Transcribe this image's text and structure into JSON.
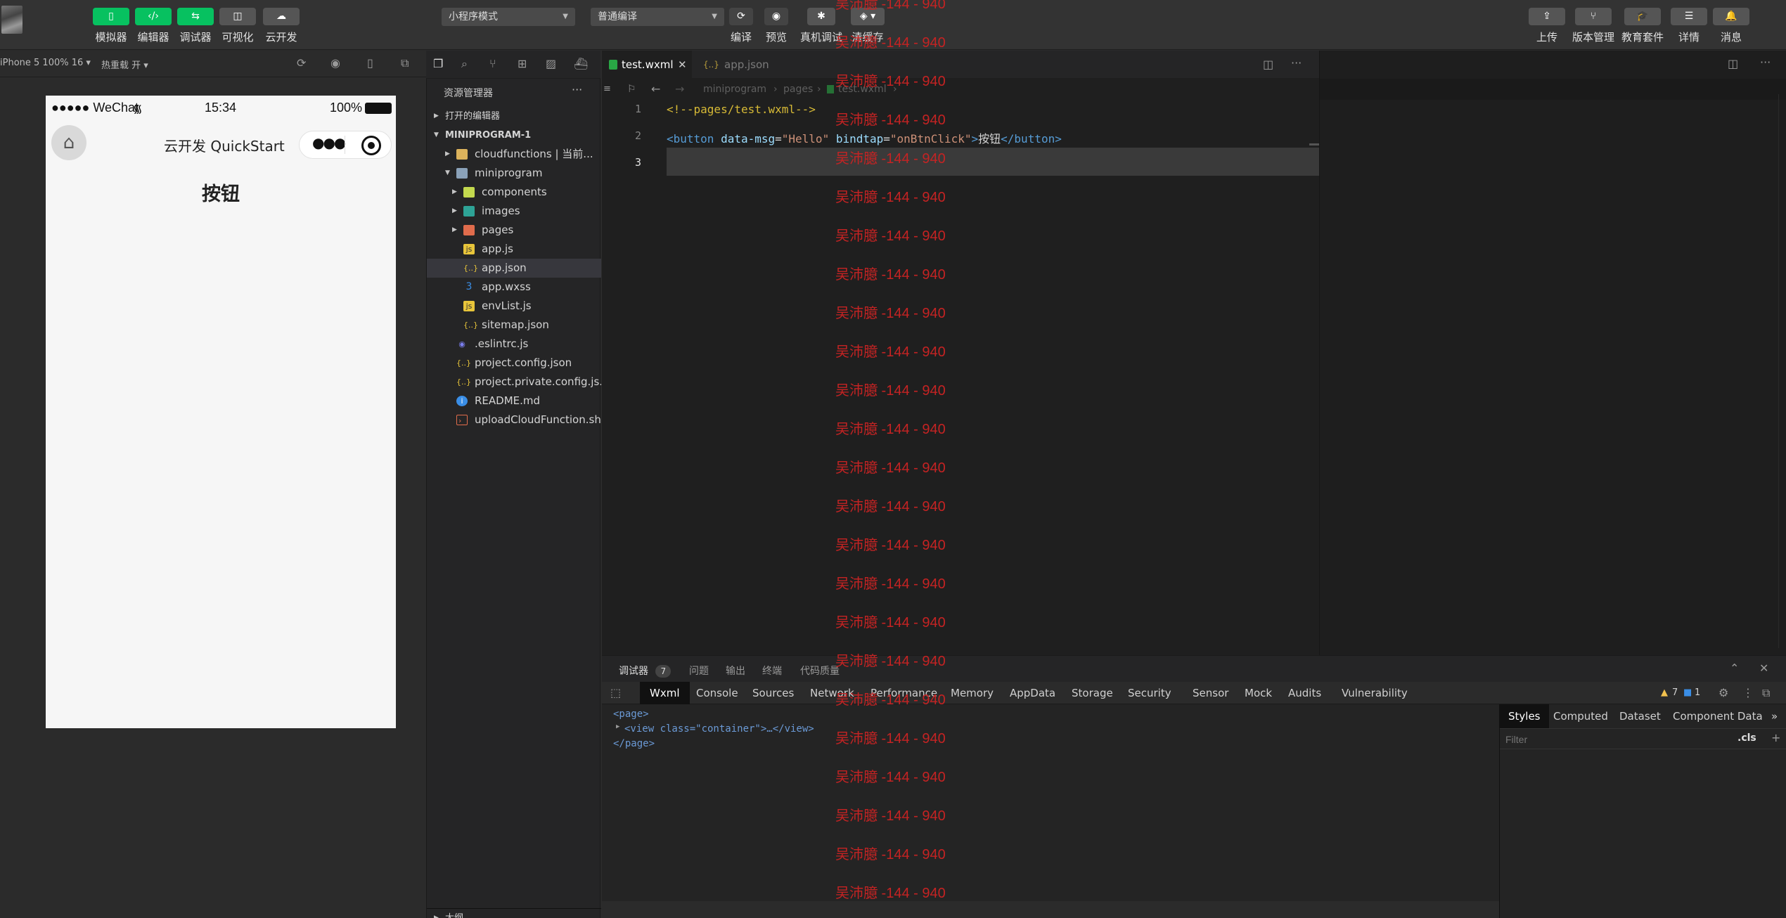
{
  "toolbar": {
    "buttons": [
      {
        "label": "模拟器",
        "icon": "phone-icon"
      },
      {
        "label": "编辑器",
        "icon": "code-icon"
      },
      {
        "label": "调试器",
        "icon": "debug-arrows-icon"
      },
      {
        "label": "可视化",
        "icon": "layout-icon"
      },
      {
        "label": "云开发",
        "icon": "cloud-icon"
      }
    ],
    "mode_select": "小程序模式",
    "compile_select": "普通编译",
    "center_buttons": [
      "编译",
      "预览",
      "真机调试",
      "清缓存"
    ],
    "right_buttons": [
      "上传",
      "版本管理",
      "教育套件",
      "详情",
      "消息"
    ],
    "accent": "#07c160"
  },
  "simulator": {
    "device": "iPhone 5 100% 16 ▾",
    "hot_reload": "热重载 开 ▾",
    "status_carrier": "●●●●● WeChat",
    "status_time": "15:34",
    "status_battery": "100%",
    "nav_title": "云开发 QuickStart",
    "page_button": "按钮"
  },
  "explorer": {
    "title": "资源管理器",
    "more": "···",
    "open_editors": "打开的编辑器",
    "project": "MINIPROGRAM-1",
    "items": [
      {
        "label": "cloudfunctions | 当前...",
        "icon": "folder-icon"
      },
      {
        "label": "miniprogram",
        "icon": "folder-open-icon"
      },
      {
        "label": "components",
        "icon": "folder-components-icon"
      },
      {
        "label": "images",
        "icon": "folder-images-icon"
      },
      {
        "label": "pages",
        "icon": "folder-pages-icon"
      },
      {
        "label": "app.js",
        "icon": "js-file-icon"
      },
      {
        "label": "app.json",
        "icon": "json-file-icon"
      },
      {
        "label": "app.wxss",
        "icon": "css-file-icon"
      },
      {
        "label": "envList.js",
        "icon": "js-file-icon"
      },
      {
        "label": "sitemap.json",
        "icon": "json-file-icon"
      },
      {
        "label": ".eslintrc.js",
        "icon": "eslint-file-icon"
      },
      {
        "label": "project.config.json",
        "icon": "json-file-icon"
      },
      {
        "label": "project.private.config.js...",
        "icon": "json-file-icon"
      },
      {
        "label": "README.md",
        "icon": "info-file-icon"
      },
      {
        "label": "uploadCloudFunction.sh",
        "icon": "shell-file-icon"
      }
    ],
    "outline": "大纲"
  },
  "editor": {
    "tabs": [
      {
        "label": "test.wxml",
        "active": true
      },
      {
        "label": "app.json",
        "active": false
      }
    ],
    "breadcrumb": [
      "miniprogram",
      "pages",
      "test.wxml"
    ],
    "line_numbers": [
      "1",
      "2",
      "3"
    ],
    "line1": "<!--pages/test.wxml-->",
    "line2": {
      "open": "<button ",
      "attr1": "data-msg",
      "eq": "=",
      "val1": "\"Hello\"",
      "attr2": " bindtap",
      "val2": "\"onBtnClick\"",
      "close": ">",
      "text": "按钮",
      "end": "</button>"
    }
  },
  "panel": {
    "tabs": [
      {
        "label": "调试器",
        "badge": "7"
      },
      {
        "label": "问题"
      },
      {
        "label": "输出"
      },
      {
        "label": "终端"
      },
      {
        "label": "代码质量"
      }
    ],
    "devtools_tabs": [
      "Wxml",
      "Console",
      "Sources",
      "Network",
      "Performance",
      "Memory",
      "AppData",
      "Storage",
      "Security",
      "Sensor",
      "Mock",
      "Audits",
      "Vulnerability"
    ],
    "warnings": "7",
    "errors": "1",
    "dom": [
      "<page>",
      "<view class=\"container\">…</view>",
      "</page>"
    ],
    "styles_tabs": [
      "Styles",
      "Computed",
      "Dataset",
      "Component Data"
    ],
    "filter_placeholder": "Filter",
    "cls": ".cls",
    "more": "»"
  },
  "watermark": "吴沛臆 -144 - 940"
}
